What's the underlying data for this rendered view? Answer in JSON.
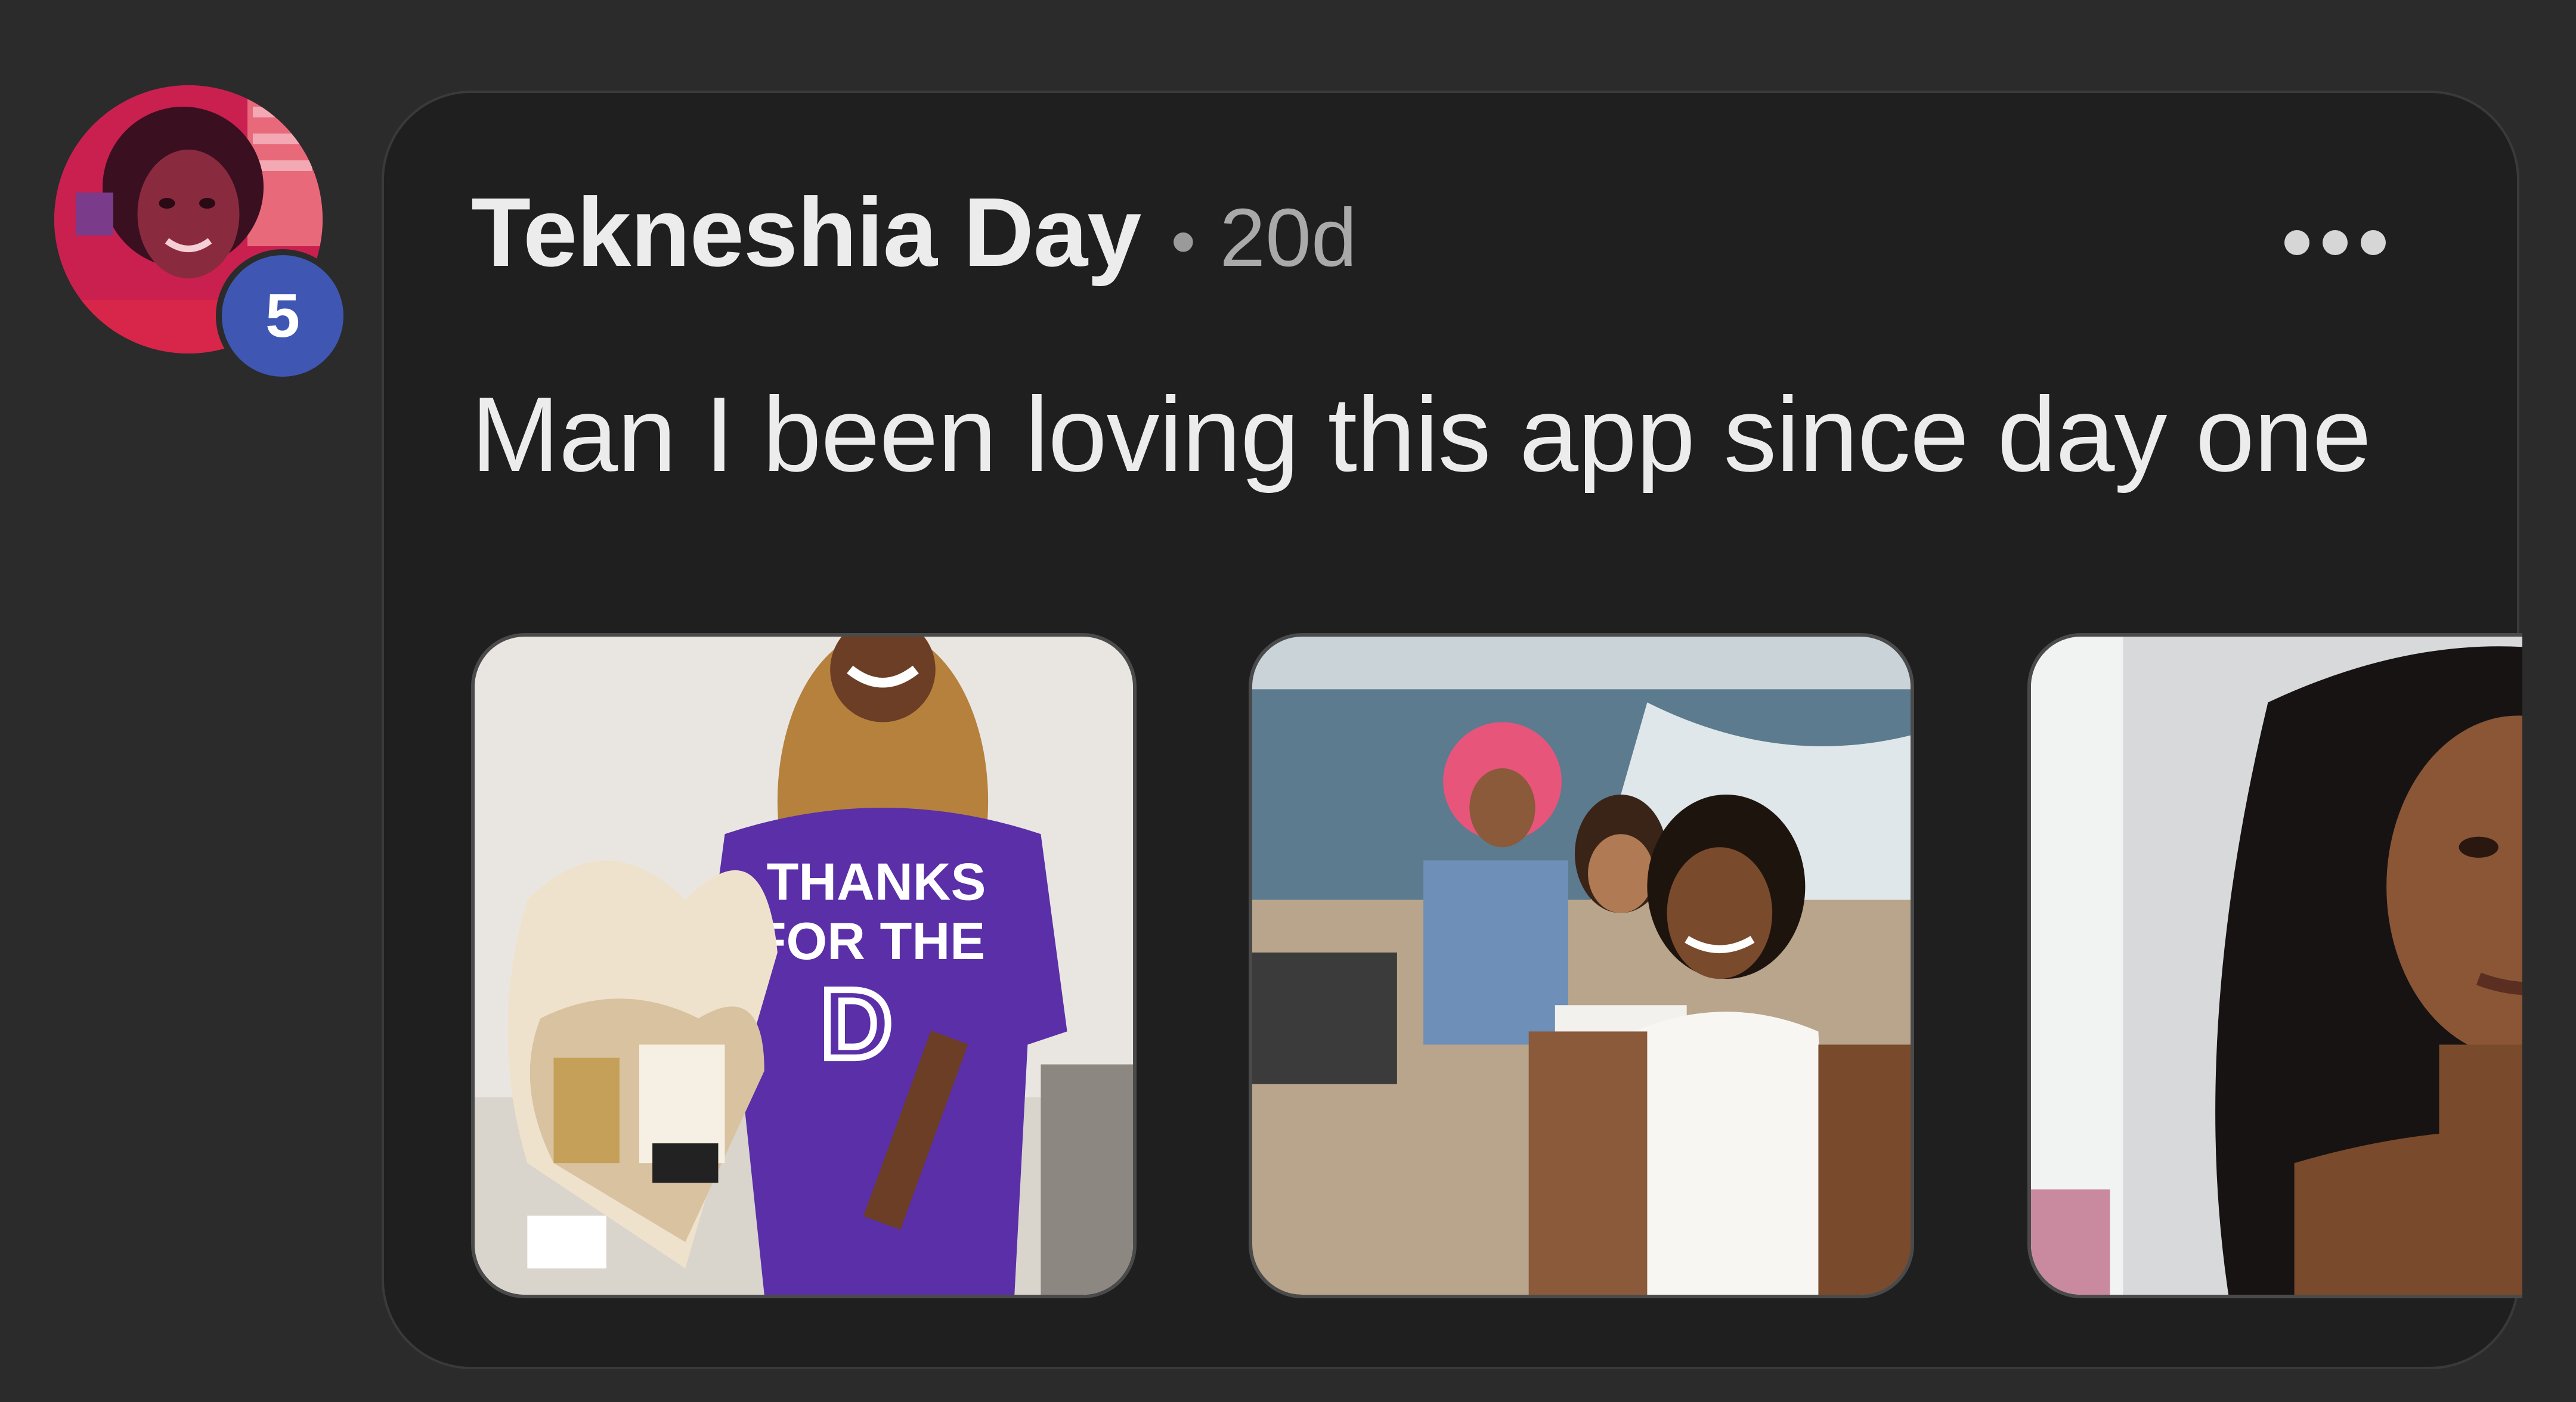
{
  "comment": {
    "author": "Tekneshia Day",
    "separator": "•",
    "time": "20d",
    "text": "Man I been loving this app since day one",
    "badge_count": "5"
  },
  "images": [
    {
      "description_icon": "photo-purple-shirt",
      "shirt_text": "THANKS FOR THE D"
    },
    {
      "description_icon": "photo-boat-selfie"
    },
    {
      "description_icon": "photo-portrait"
    }
  ],
  "colors": {
    "background": "#2b2b2c",
    "card": "#1f1f1f",
    "badge": "#3f57b3",
    "text_primary": "#ececec",
    "text_secondary": "#a9a9a9"
  }
}
